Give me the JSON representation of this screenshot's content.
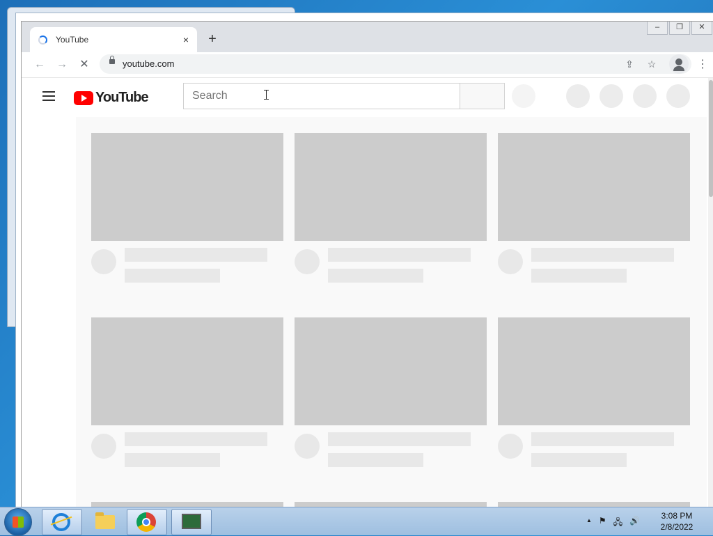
{
  "browser": {
    "tab": {
      "title": "YouTube",
      "close_glyph": "×"
    },
    "new_tab_glyph": "+",
    "window_controls": [
      "–",
      "❐",
      "✕"
    ],
    "background_window_controls": [
      "–",
      "❐",
      "✕"
    ],
    "nav": {
      "back_glyph": "←",
      "forward_glyph": "→",
      "stop_glyph": "✕"
    },
    "address": {
      "url": "youtube.com"
    },
    "actions": {
      "share_glyph": "⇪",
      "bookmark_glyph": "☆",
      "menu_glyph": "⋮"
    }
  },
  "youtube": {
    "logo_text": "YouTube",
    "search": {
      "placeholder": "Search",
      "value": ""
    },
    "feed_placeholders": 9
  },
  "taskbar": {
    "pinned": [
      "internet-explorer",
      "windows-explorer",
      "google-chrome",
      "task-manager"
    ],
    "tray_up_glyph": "▲",
    "clock": {
      "time": "3:08 PM",
      "date": "2/8/2022"
    }
  },
  "colors": {
    "youtube_red": "#ff0000",
    "skeleton": "#cccccc",
    "skeleton_light": "#e8e8e8",
    "chrome_frame": "#dee1e6",
    "spinner_blue": "#1a73e8"
  }
}
